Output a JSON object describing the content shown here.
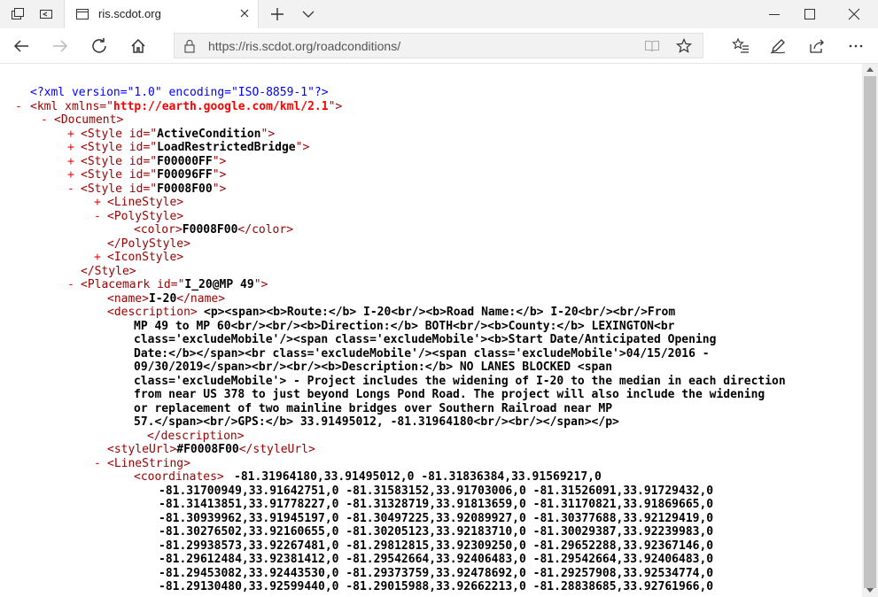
{
  "tab": {
    "title": "ris.scdot.org"
  },
  "address_bar": {
    "url": "https://ris.scdot.org/roadconditions/"
  },
  "xml": {
    "declaration": "<?xml version=\"1.0\" encoding=\"ISO-8859-1\"?>",
    "kml_open": "<kml xmlns=\"",
    "kml_ns": "http://earth.google.com/kml/2.1",
    "kml_close": "\">",
    "document": "<Document>",
    "style1": "<Style id=\"",
    "style1_val": "ActiveCondition",
    "style2_val": "LoadRestrictedBridge",
    "style3_val": "F00000FF",
    "style4_val": "F00096FF",
    "style5_val": "F0008F00",
    "close_attr": "\">",
    "linestyle": "<LineStyle>",
    "polystyle": "<PolyStyle>",
    "color_open": "<color>",
    "color_val": "F0008F00",
    "color_close": "</color>",
    "polystyle_close": "</PolyStyle>",
    "iconstyle": "<IconStyle>",
    "style_close": "</Style>",
    "placemark_open": "<Placemark id=\"",
    "placemark_id": "I_20@MP 49",
    "name_open": "<name>",
    "name_val": "I-20",
    "name_close": "</name>",
    "description_open": "<description>",
    "description_lines": [
      "<p><span><b>Route:</b> I-20<br/><b>Road Name:</b> I-20<br/><br/>From",
      "MP 49 to MP 60<br/><br/><b>Direction:</b> BOTH<br/><b>County:</b> LEXINGTON<br",
      "class='excludeMobile'/><span class='excludeMobile'><b>Start Date/Anticipated Opening",
      "Date:</b></span><br class='excludeMobile'/><span class='excludeMobile'>04/15/2016 -",
      "09/30/2019</span><br/><br/><b>Description:</b> NO LANES BLOCKED <span",
      "class='excludeMobile'> - Project includes the widening of I-20 to the median in each direction",
      "from near US 378 to just beyond Longs Pond Road. The project will also include the widening",
      "or replacement of two mainline bridges over Southern Railroad near MP",
      "57.</span><br/>GPS:</b> 33.91495012, -81.31964180<br/><br/></span></p>"
    ],
    "description_close": "</description>",
    "styleurl_open": "<styleUrl>",
    "styleurl_val": "#F0008F00",
    "styleurl_close": "</styleUrl>",
    "linestring": "<LineString>",
    "coordinates_open": "<coordinates>",
    "coordinate_lines": [
      "-81.31964180,33.91495012,0 -81.31836384,33.91569217,0",
      "-81.31700949,33.91642751,0 -81.31583152,33.91703006,0 -81.31526091,33.91729432,0",
      "-81.31413851,33.91778227,0 -81.31328719,33.91813659,0 -81.31170821,33.91869665,0",
      "-81.30939962,33.91945197,0 -81.30497225,33.92089927,0 -81.30377688,33.92129419,0",
      "-81.30276502,33.92160655,0 -81.30205123,33.92183710,0 -81.30029387,33.92239983,0",
      "-81.29938573,33.92267481,0 -81.29812815,33.92309250,0 -81.29652288,33.92367146,0",
      "-81.29612484,33.92381412,0 -81.29542664,33.92406483,0 -81.29542664,33.92406483,0",
      "-81.29453082,33.92443530,0 -81.29373759,33.92478692,0 -81.29257908,33.92534774,0",
      "-81.29130480,33.92599440,0 -81.29015988,33.92662213,0 -81.28838685,33.92761966,0"
    ],
    "toggles": {
      "minus": "-",
      "plus": "+"
    }
  },
  "colors": {
    "tag": "#990000",
    "pi": "#0000ff",
    "toggle": "#ff0000",
    "url": "#ff0000"
  }
}
